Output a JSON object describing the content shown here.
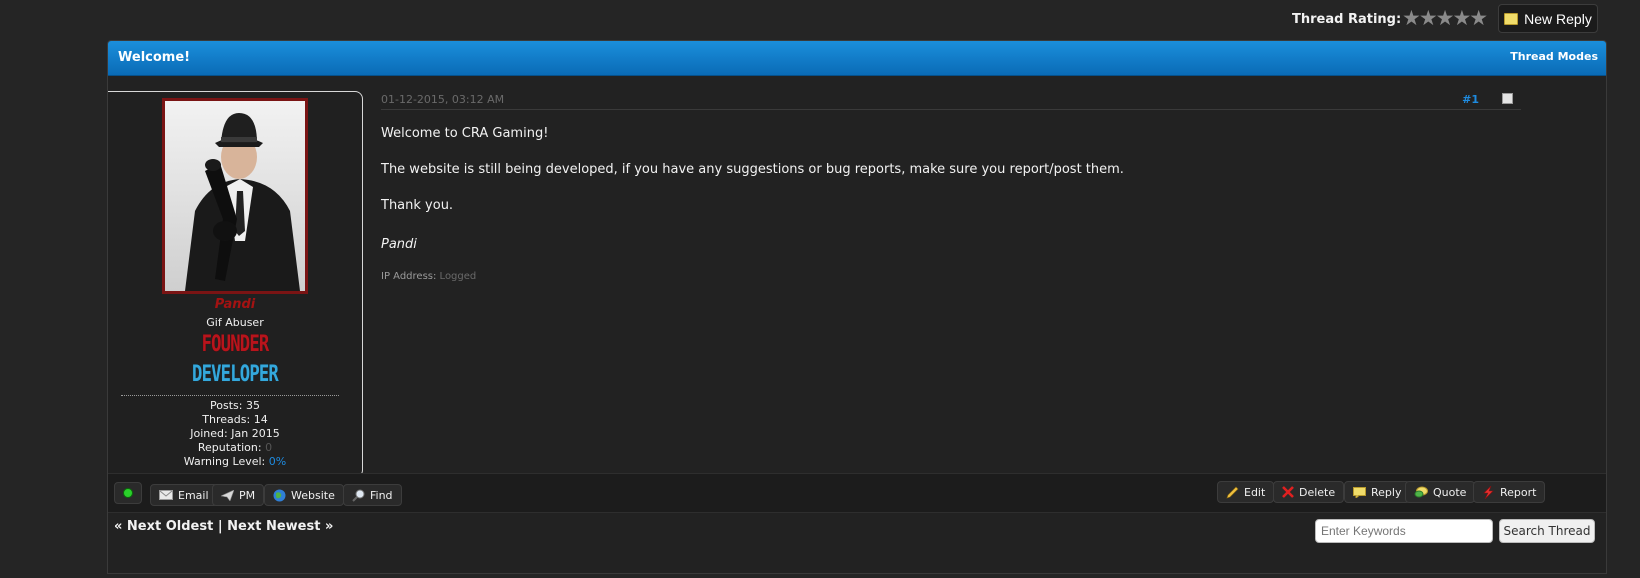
{
  "top": {
    "rating_label": "Thread Rating:",
    "stars": "★★★★★",
    "new_reply_label": "New Reply"
  },
  "thread": {
    "title": "Welcome!",
    "modes_label": "Thread Modes"
  },
  "user": {
    "username": "Pandi",
    "user_title": "Gif Abuser",
    "badges": [
      "FOUNDER",
      "DEVELOPER"
    ],
    "stats": {
      "posts_label": "Posts:",
      "posts": "35",
      "threads_label": "Threads:",
      "threads": "14",
      "joined_label": "Joined:",
      "joined": "Jan 2015",
      "reputation_label": "Reputation:",
      "reputation": "0",
      "warning_label": "Warning Level:",
      "warning": "0%"
    }
  },
  "post": {
    "date": "01-12-2015, 03:12 AM",
    "number": "#1",
    "paragraphs": [
      "Welcome to CRA Gaming!",
      "The website is still being developed, if you have any suggestions or bug reports, make sure you report/post them.",
      "Thank you."
    ],
    "signature": "Pandi",
    "ip_label": "IP Address:",
    "ip_value": "Logged"
  },
  "controls": {
    "left": {
      "email": "Email",
      "pm": "PM",
      "website": "Website",
      "find": "Find"
    },
    "right": {
      "edit": "Edit",
      "delete": "Delete",
      "reply": "Reply",
      "quote": "Quote",
      "report": "Report"
    }
  },
  "nav": {
    "next_oldest": "« Next Oldest",
    "separator": "|",
    "next_newest": "Next Newest »"
  },
  "search": {
    "placeholder": "Enter Keywords",
    "button_label": "Search Thread"
  },
  "colors": {
    "header_blue": "#0a6bb6",
    "username_red": "#a41212",
    "link_blue": "#1e8be0",
    "founder_red": "#b8141c",
    "developer_blue": "#34a8dc"
  }
}
